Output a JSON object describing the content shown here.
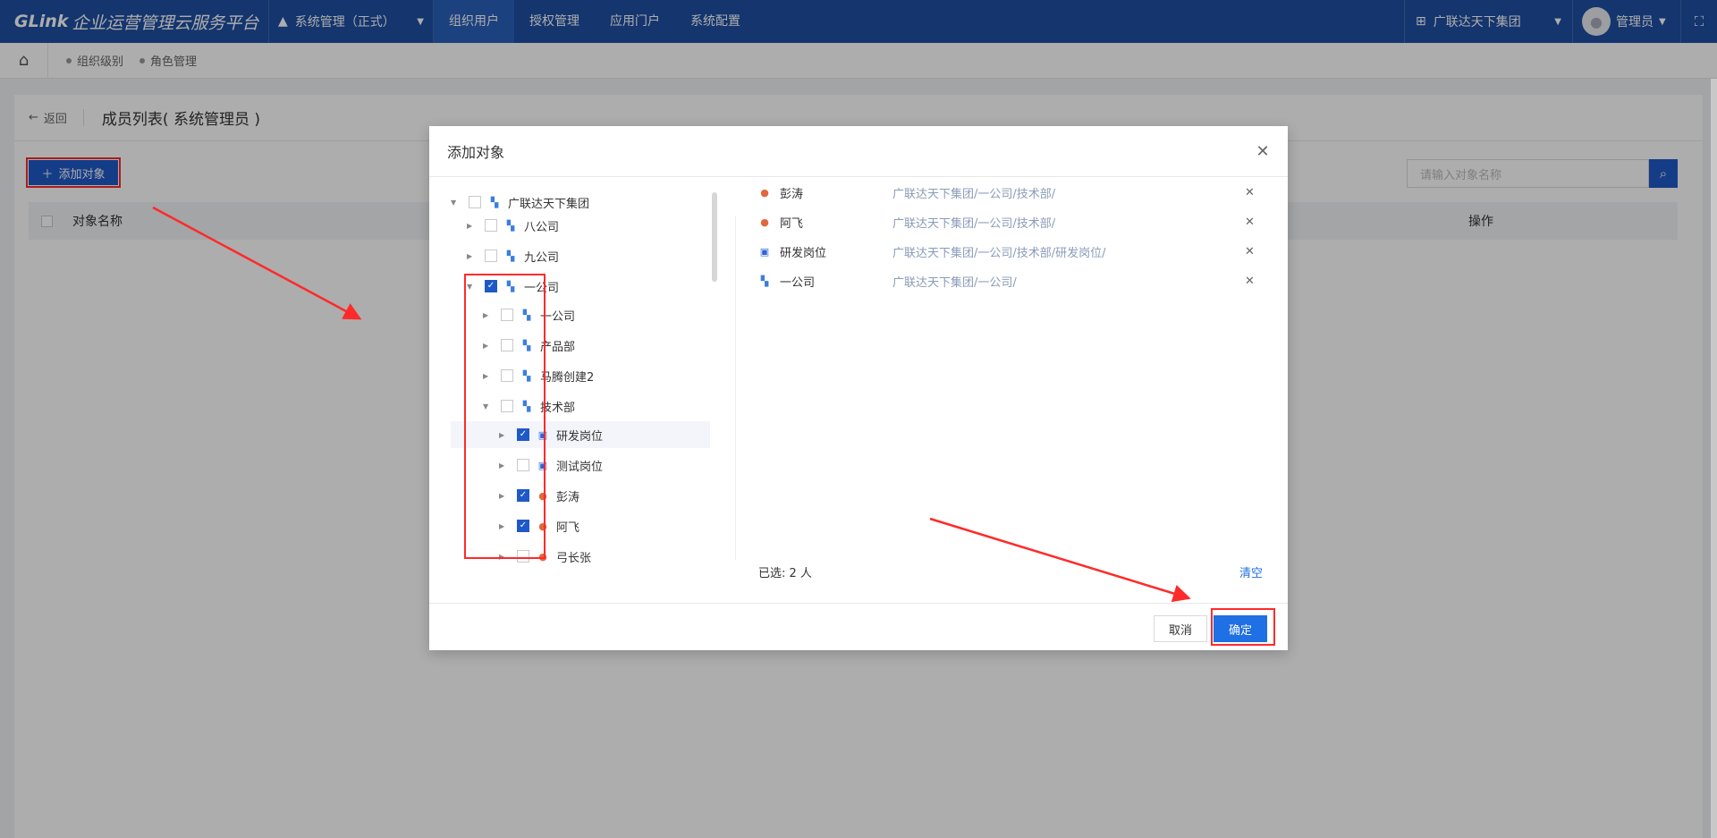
{
  "header": {
    "logo_mark": "GLink",
    "platform_title": "企业运营管理云服务平台",
    "system_label": "系统管理（正式）",
    "nav": [
      "组织用户",
      "授权管理",
      "应用门户",
      "系统配置"
    ],
    "org_label": "广联达天下集团",
    "user_label": "管理员"
  },
  "breadcrumb": {
    "items": [
      "组织级别",
      "角色管理"
    ]
  },
  "page": {
    "back_label": "返回",
    "title": "成员列表( 系统管理员 )",
    "add_button": "添加对象",
    "search_placeholder": "请输入对象名称",
    "columns": {
      "name": "对象名称",
      "action": "操作"
    }
  },
  "dialog": {
    "title": "添加对象",
    "tree": [
      {
        "label": "广联达天下集团",
        "type": "org",
        "checked": false
      },
      {
        "label": "八公司",
        "type": "org",
        "checked": false
      },
      {
        "label": "九公司",
        "type": "org",
        "checked": false
      },
      {
        "label": "一公司",
        "type": "org",
        "checked": true
      },
      {
        "label": "一公司",
        "type": "org",
        "checked": false
      },
      {
        "label": "产品部",
        "type": "org",
        "checked": false
      },
      {
        "label": "马腾创建2",
        "type": "org",
        "checked": false
      },
      {
        "label": "技术部",
        "type": "org",
        "checked": false
      },
      {
        "label": "研发岗位",
        "type": "post",
        "checked": true
      },
      {
        "label": "测试岗位",
        "type": "post",
        "checked": false
      },
      {
        "label": "彭涛",
        "type": "user",
        "checked": true
      },
      {
        "label": "阿飞",
        "type": "user",
        "checked": true
      },
      {
        "label": "弓长张",
        "type": "user",
        "checked": false
      }
    ],
    "selected": [
      {
        "name": "彭涛",
        "type": "user",
        "path": "广联达天下集团/一公司/技术部/"
      },
      {
        "name": "阿飞",
        "type": "user",
        "path": "广联达天下集团/一公司/技术部/"
      },
      {
        "name": "研发岗位",
        "type": "post",
        "path": "广联达天下集团/一公司/技术部/研发岗位/"
      },
      {
        "name": "一公司",
        "type": "org",
        "path": "广联达天下集团/一公司/"
      }
    ],
    "selected_count": "已选: 2 人",
    "clear_label": "清空",
    "cancel_label": "取消",
    "confirm_label": "确定"
  },
  "icons": {
    "org": "org-tree-icon",
    "post": "post-icon",
    "user": "user-icon"
  },
  "colors": {
    "header": "#1e4fa3",
    "primary": "#1f6fe5",
    "annotation": "#ff2a2a"
  }
}
